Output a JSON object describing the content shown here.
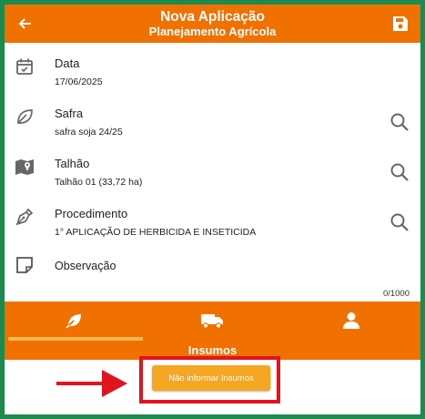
{
  "header": {
    "title": "Nova Aplicação",
    "subtitle": "Planejamento Agrícola",
    "back_icon": "arrow-left-icon",
    "save_icon": "floppy-disk-icon"
  },
  "fields": {
    "data": {
      "label": "Data",
      "value": "17/06/2025",
      "icon": "calendar-icon"
    },
    "safra": {
      "label": "Safra",
      "value": "safra soja 24/25",
      "icon": "leaf-icon"
    },
    "talhao": {
      "label": "Talhão",
      "value": "Talhão 01 (33,72 ha)",
      "icon": "map-icon"
    },
    "procedimento": {
      "label": "Procedimento",
      "value": "1° APLICAÇÃO DE HERBICIDA E INSETICIDA",
      "icon": "pen-nib-icon"
    },
    "observacao": {
      "label": "Observação",
      "counter": "0/1000",
      "icon": "note-icon"
    }
  },
  "tabs": {
    "items": [
      {
        "icon": "leaf-icon",
        "selected": true
      },
      {
        "icon": "truck-icon",
        "selected": false
      },
      {
        "icon": "person-icon",
        "selected": false
      }
    ],
    "section_title": "Insumos"
  },
  "actions": {
    "skip_label": "Não informar Insumos"
  },
  "colors": {
    "primary": "#f07000",
    "accent": "#f5a623",
    "highlight": "#e0141f",
    "frame": "#1e8a4e"
  }
}
